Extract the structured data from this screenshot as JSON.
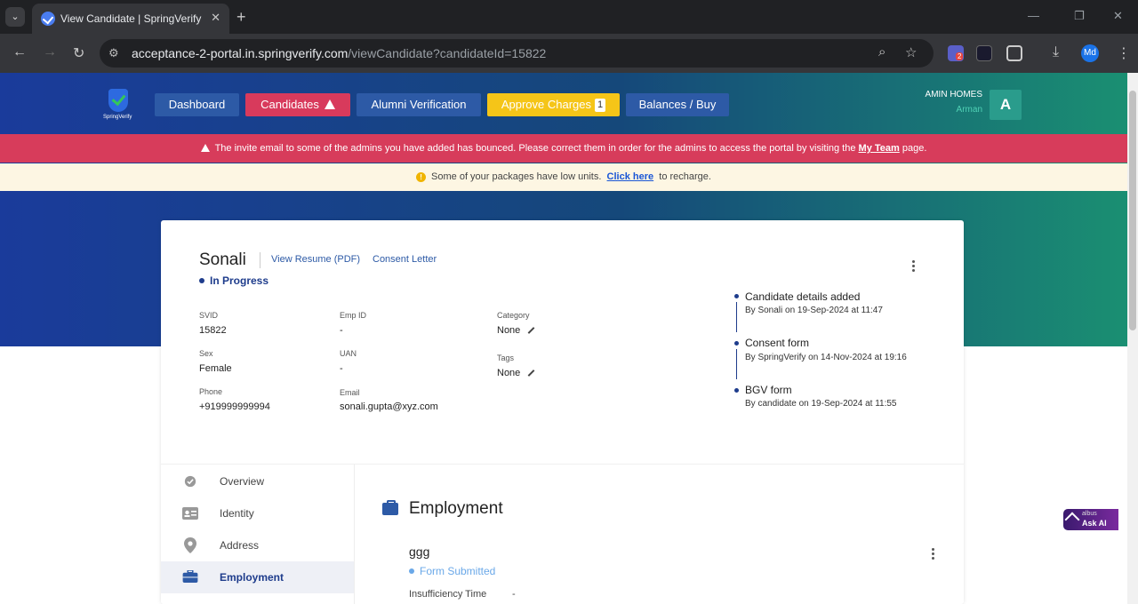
{
  "browser": {
    "tab_title": "View Candidate | SpringVerify",
    "url_host": "acceptance-2-portal.in.springverify.com",
    "url_path": "/viewCandidate?candidateId=15822",
    "profile_initials": "Md",
    "ext_badge": "2"
  },
  "header": {
    "logo_text": "SpringVerify",
    "nav": {
      "dashboard": "Dashboard",
      "candidates": "Candidates",
      "alumni": "Alumni Verification",
      "approve": "Approve Charges",
      "approve_count": "1",
      "balances": "Balances / Buy"
    },
    "company": "AMIN HOMES",
    "user": "Arman",
    "avatar_letter": "A"
  },
  "alerts": {
    "bounce_text": "The invite email to some of the admins you have added has bounced. Please correct them in order for the admins to access the portal by visiting the",
    "bounce_link": "My Team",
    "bounce_suffix": "page.",
    "low_units_text": "Some of your packages have low units.",
    "low_units_link": "Click here",
    "low_units_suffix": "to recharge."
  },
  "candidate": {
    "name": "Sonali",
    "view_resume": "View Resume (PDF)",
    "consent_letter": "Consent Letter",
    "status": "In Progress",
    "fields": {
      "svid_label": "SVID",
      "svid": "15822",
      "empid_label": "Emp ID",
      "empid": "-",
      "category_label": "Category",
      "category": "None",
      "sex_label": "Sex",
      "sex": "Female",
      "uan_label": "UAN",
      "uan": "-",
      "tags_label": "Tags",
      "tags": "None",
      "phone_label": "Phone",
      "phone": "+919999999994",
      "email_label": "Email",
      "email": "sonali.gupta@xyz.com"
    }
  },
  "timeline": [
    {
      "title": "Candidate details added",
      "sub": "By Sonali on 19-Sep-2024 at 11:47"
    },
    {
      "title": "Consent form",
      "sub": "By SpringVerify on 14-Nov-2024 at 19:16"
    },
    {
      "title": "BGV form",
      "sub": "By candidate on 19-Sep-2024 at 11:55"
    }
  ],
  "sidebar": {
    "items": [
      {
        "label": "Overview",
        "icon": "check-circle-icon"
      },
      {
        "label": "Identity",
        "icon": "id-card-icon"
      },
      {
        "label": "Address",
        "icon": "map-pin-icon"
      },
      {
        "label": "Employment",
        "icon": "briefcase-icon"
      }
    ]
  },
  "employment": {
    "title": "Employment",
    "company": "ggg",
    "status": "Form Submitted",
    "insufficiency_label": "Insufficiency Time",
    "insufficiency_value": "-"
  },
  "askai": {
    "brand": "albus",
    "label": "Ask AI"
  },
  "colors": {
    "primary": "#2d5aa6",
    "danger": "#d73c5b",
    "warning": "#f5c518",
    "status_blue": "#1e3c8c"
  }
}
